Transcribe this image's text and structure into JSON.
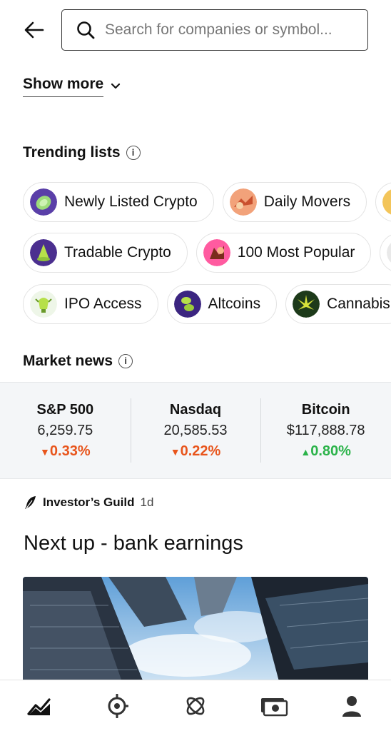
{
  "search": {
    "placeholder": "Search for companies or symbol..."
  },
  "show_more": {
    "label": "Show more"
  },
  "trending": {
    "title": "Trending lists",
    "rows": [
      [
        {
          "label": "Newly Listed Crypto",
          "icon": "crypto-coin-icon"
        },
        {
          "label": "Daily Movers",
          "icon": "daily-movers-icon"
        },
        {
          "label": "",
          "icon": "list-icon"
        }
      ],
      [
        {
          "label": "Tradable Crypto",
          "icon": "crypto-cone-icon"
        },
        {
          "label": "100 Most Popular",
          "icon": "popular-icon"
        },
        {
          "label": "",
          "icon": "list-icon"
        }
      ],
      [
        {
          "label": "IPO Access",
          "icon": "ipo-bell-icon"
        },
        {
          "label": "Altcoins",
          "icon": "altcoin-icon"
        },
        {
          "label": "Cannabis",
          "icon": "cannabis-leaf-icon"
        }
      ]
    ]
  },
  "market_news": {
    "title": "Market news",
    "indices": [
      {
        "name": "S&P 500",
        "value": "6,259.75",
        "change": "0.33%",
        "direction": "down"
      },
      {
        "name": "Nasdaq",
        "value": "20,585.53",
        "change": "0.22%",
        "direction": "down"
      },
      {
        "name": "Bitcoin",
        "value": "$117,888.78",
        "change": "0.80%",
        "direction": "up"
      }
    ]
  },
  "article": {
    "source": "Investor’s Guild",
    "age": "1d",
    "headline": "Next up - bank earnings"
  },
  "nav": {
    "items": [
      "investing-icon",
      "crypto-icon",
      "explore-icon",
      "cash-icon",
      "account-icon"
    ]
  },
  "colors": {
    "down": "#e8551c",
    "up": "#2bb34a"
  }
}
